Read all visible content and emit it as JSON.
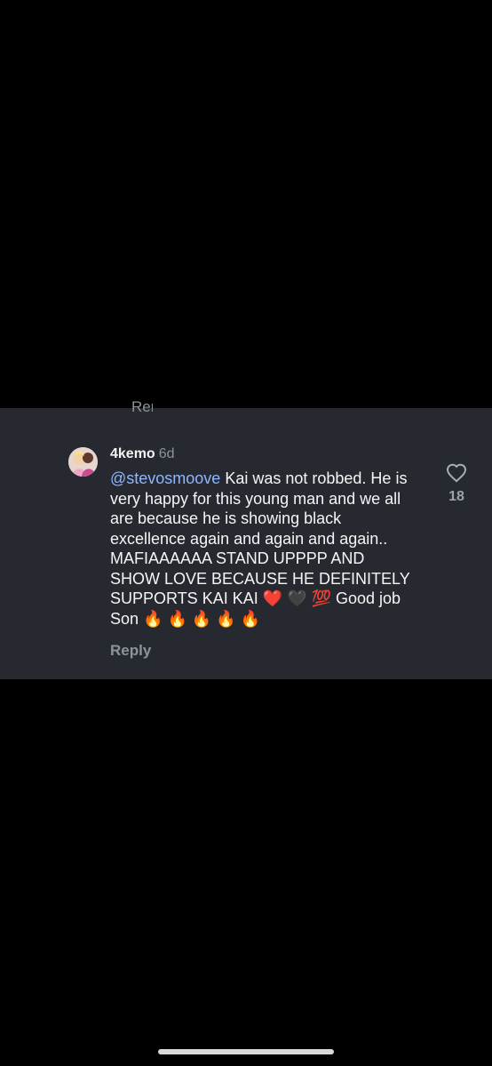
{
  "comment": {
    "cut_reply_label": "Reply",
    "username": "4kemo",
    "time_ago": "6d",
    "mention": "@stevosmoove",
    "text": " Kai was not robbed. He is very happy for this young man and we all are because he is showing black excellence again and again and again.. MAFIAAAAAA STAND UPPPP AND SHOW LOVE BECAUSE HE DEFINITELY SUPPORTS KAI KAI ❤️ 🖤 💯 Good job Son 🔥 🔥 🔥 🔥 🔥",
    "reply_label": "Reply",
    "like_count": "18"
  },
  "icons": {
    "like": "heart-outline-icon",
    "avatar": "profile-avatar"
  },
  "colors": {
    "background": "#000000",
    "panel": "#262a30",
    "mention": "#8fb6ff",
    "secondary_text": "#8e939a"
  }
}
